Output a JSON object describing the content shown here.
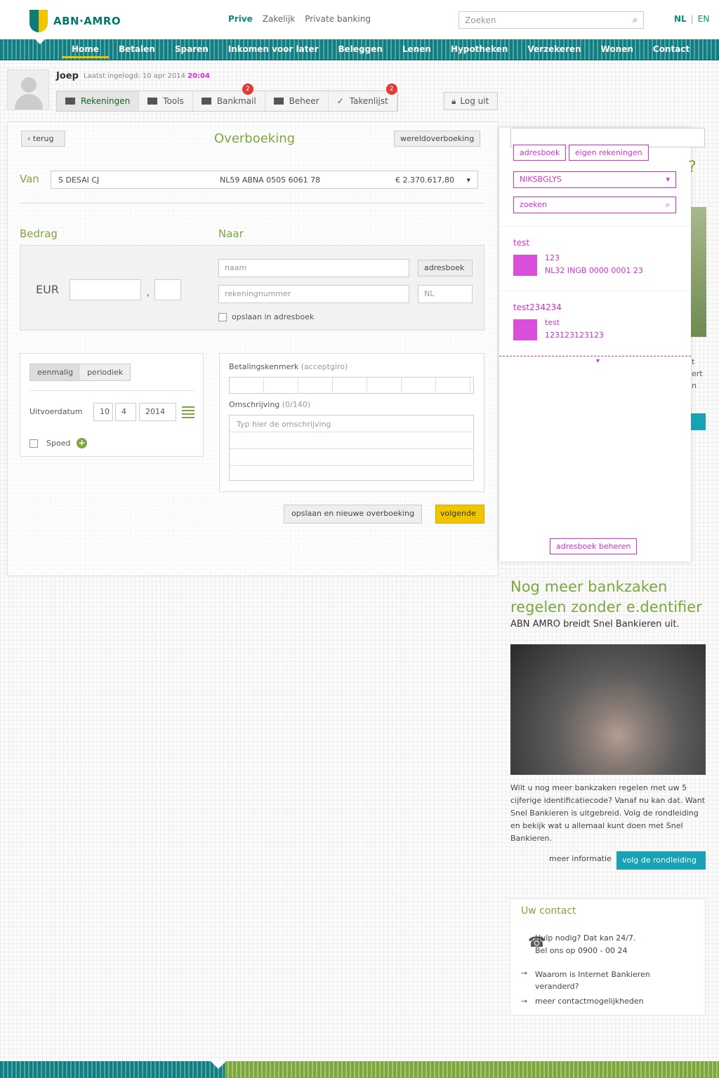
{
  "header": {
    "brand": "ABN·AMRO",
    "nav": [
      "Prive",
      "Zakelijk",
      "Private banking"
    ],
    "search_placeholder": "Zoeken",
    "lang_nl": "NL",
    "lang_sep": "|",
    "lang_en": "EN"
  },
  "mainnav": [
    "Home",
    "Betalen",
    "Sparen",
    "Inkomen voor later",
    "Beleggen",
    "Lenen",
    "Hypotheken",
    "Verzekeren",
    "Wonen",
    "Contact"
  ],
  "user": {
    "name": "Joep",
    "last_login_label": "Laatst ingelogd: 10 apr 2014",
    "last_login_time": "20:04"
  },
  "userbar": {
    "items": [
      "Rekeningen",
      "Tools",
      "Bankmail",
      "Beheer",
      "Takenlijst"
    ],
    "bankmail_badge": "2",
    "takenlijst_badge": "2",
    "logout": "Log uit"
  },
  "transfer": {
    "back": "terug",
    "title": "Overboeking",
    "world": "wereldoverboeking",
    "van_label": "Van",
    "van_name": "S DESAI CJ",
    "van_iban": "NL59 ABNA 0505 6061 78",
    "van_balance": "€ 2.370.617,80",
    "bedrag_label": "Bedrag",
    "naar_label": "Naar",
    "currency": "EUR",
    "decimal_sep": ",",
    "naam_ph": "naam",
    "adresboek": "adresboek",
    "rekening_ph": "rekeningnummer",
    "country": "NL",
    "opslaan": "opslaan in adresboek",
    "eenmalig": "eenmalig",
    "periodiek": "periodiek",
    "uitvoer_label": "Uitvoerdatum",
    "day": "10",
    "month": "4",
    "year": "2014",
    "spoed": "Spoed",
    "betaling_label": "Betalingskenmerk",
    "betaling_hint": "(acceptgiro)",
    "omschr_label": "Omschrijving",
    "omschr_hint": "(0/140)",
    "omschr_ph": "Typ hier de omschrijving",
    "save_new": "opslaan en nieuwe overboeking",
    "next": "volgende"
  },
  "addressbook": {
    "tab1": "adresboek",
    "tab2": "eigen rekeningen",
    "select": "NIKSBGLYS",
    "search_ph": "zoeken",
    "entries": [
      {
        "name": "test",
        "line1": "123",
        "line2": "NL32 INGB 0000 0001 23"
      },
      {
        "name": "test234234",
        "line1": "test",
        "line2": "123123123123"
      }
    ],
    "manage": "adresboek beheren",
    "edge1": "?",
    "edge2": "t",
    "edge3": "ert",
    "edge4": "n"
  },
  "promo": {
    "title": "Nog meer bankzaken regelen zonder e.dentifier",
    "subtitle": "ABN AMRO breidt Snel Bankieren uit.",
    "text": "Wilt u nog meer bankzaken regelen met uw 5 cijferige identificatiecode? Vanaf nu kan dat. Want Snel Bankieren is uitgebreid. Volg de rondleiding en bekijk wat u allemaal kunt doen met Snel Bankieren.",
    "more": "meer informatie",
    "button": "volg de rondleiding"
  },
  "contact": {
    "title": "Uw contact",
    "line1": "Hulp nodig? Dat kan 24/7.",
    "line2": "Bel ons op 0900 - 00 24",
    "link1": "Waarom is Internet Bankieren veranderd?",
    "link2": "meer contactmogelijkheden"
  }
}
